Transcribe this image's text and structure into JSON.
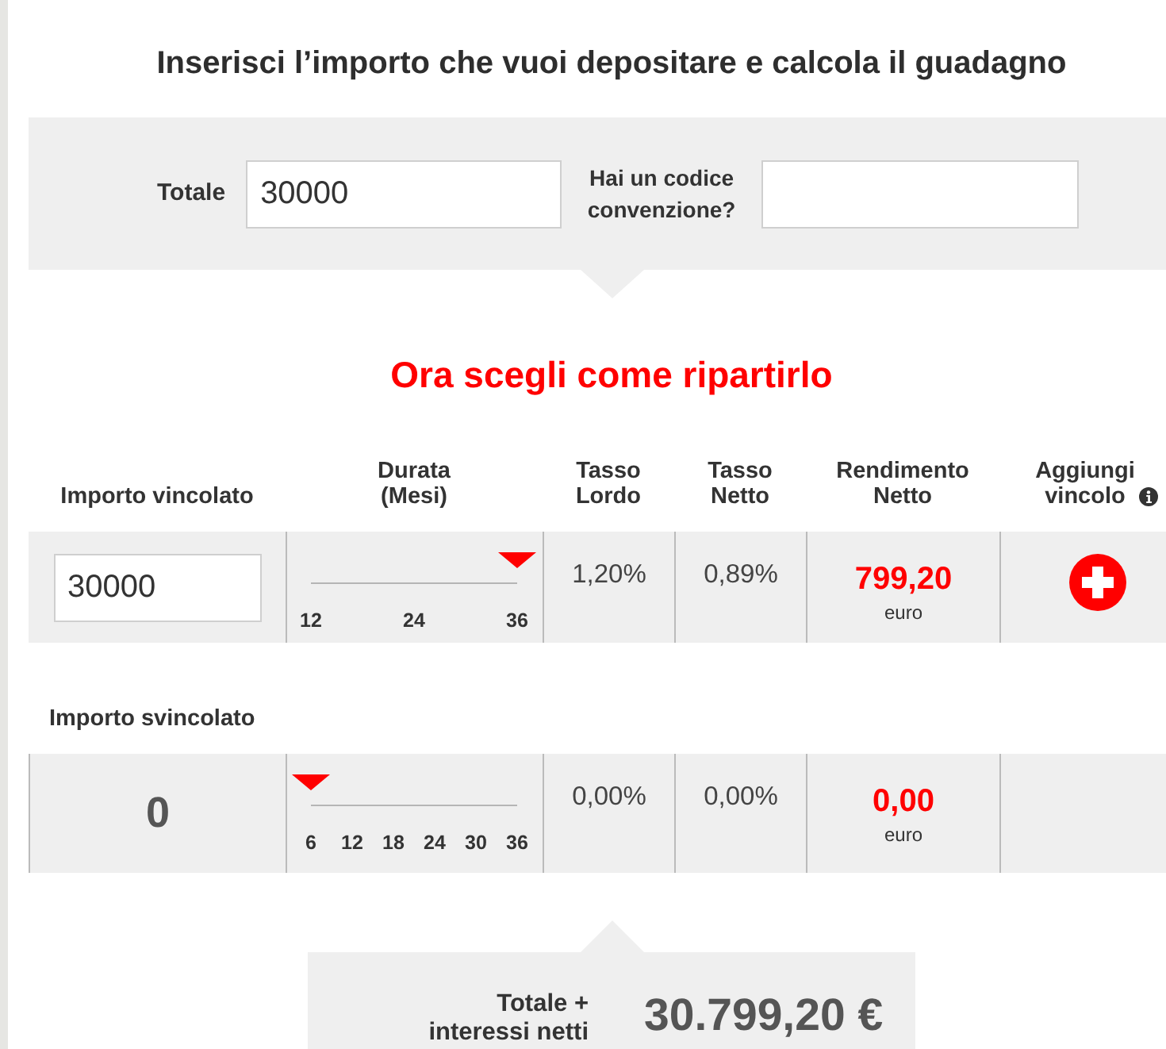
{
  "title": "Inserisci l’importo che vuoi depositare e calcola il guadagno",
  "deposit_form": {
    "total_label": "Totale",
    "total_value": "30000",
    "code_label": "Hai un codice convenzione?"
  },
  "section_heading": "Ora scegli come ripartirlo",
  "table": {
    "columns": [
      {
        "label": "Importo vincolato",
        "info_icon": false
      },
      {
        "label": "Durata (Mesi)",
        "info_icon": false
      },
      {
        "label": "Tasso Lordo",
        "info_icon": false
      },
      {
        "label": "Tasso Netto",
        "info_icon": false
      },
      {
        "label": "Rendimento Netto",
        "info_icon": false
      },
      {
        "label": "Aggiungi vincolo",
        "info_icon": true
      }
    ],
    "rows": [
      {
        "kind": "editable",
        "amount": "30000",
        "duration": {
          "ticks": [
            "12",
            "24",
            "36"
          ],
          "level": 1
        },
        "gross_rate": "1,20%",
        "net_rate": "0,89%",
        "net_yield": "799,20",
        "yield_unit": "euro",
        "add_button": true
      },
      {
        "kind": "fixed",
        "label": "Importo svincolato",
        "amount": "0",
        "duration": {
          "ticks": [
            "6",
            "12",
            "18",
            "24",
            "30",
            "36"
          ],
          "level": 0
        },
        "gross_rate": "0,00%",
        "net_rate": "0,00%",
        "net_yield": "0,00",
        "yield_unit": "euro",
        "add_button": false
      }
    ]
  },
  "summary": {
    "label": "Totale + interessi netti",
    "value": "30.799,20 €"
  }
}
